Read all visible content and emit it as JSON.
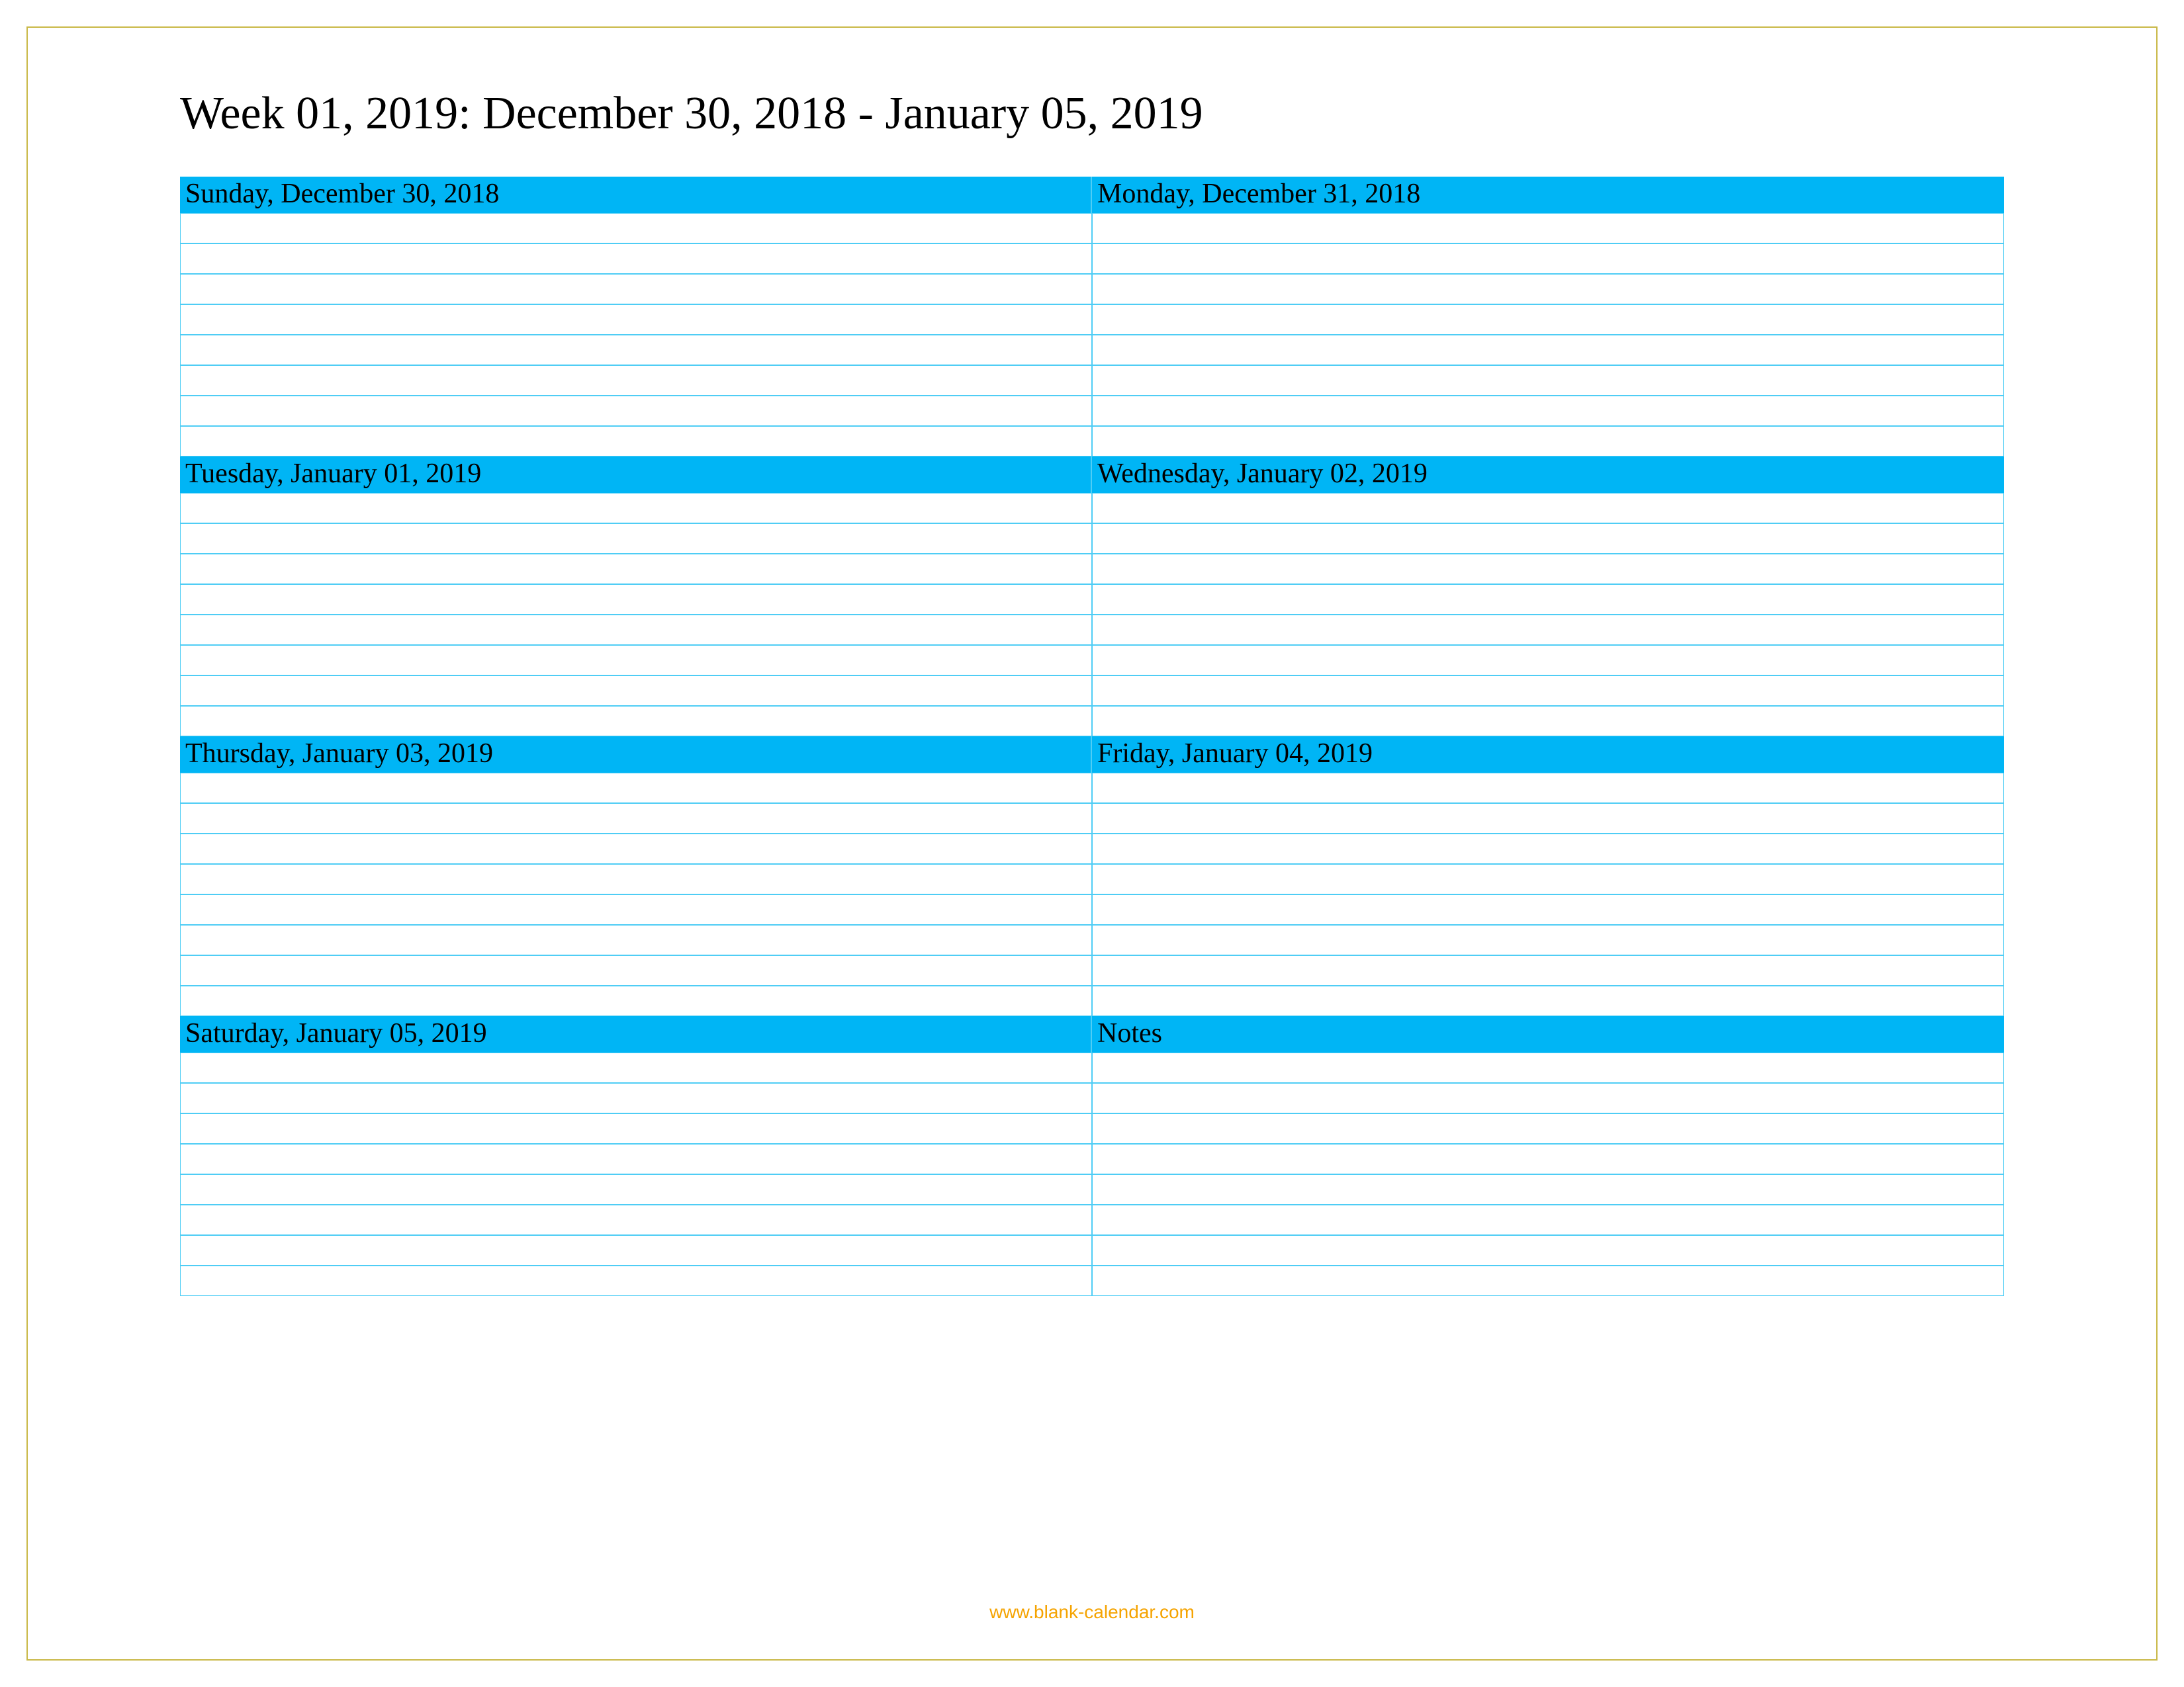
{
  "title": "Week 01, 2019: December 30, 2018 - January 05, 2019",
  "rows_per_day": 8,
  "day_pairs": [
    {
      "left": "Sunday, December 30, 2018",
      "right": "Monday, December 31, 2018"
    },
    {
      "left": "Tuesday, January 01, 2019",
      "right": "Wednesday, January 02, 2019"
    },
    {
      "left": "Thursday, January 03, 2019",
      "right": "Friday, January 04, 2019"
    },
    {
      "left": "Saturday, January 05, 2019",
      "right": "Notes"
    }
  ],
  "footer": {
    "prefix": "www.",
    "domain": "blank-calendar.com"
  },
  "colors": {
    "header_bg": "#00b5f5",
    "line_border": "#4fcdf5",
    "frame_border": "#c9b847",
    "footer_text": "#f5a300"
  }
}
